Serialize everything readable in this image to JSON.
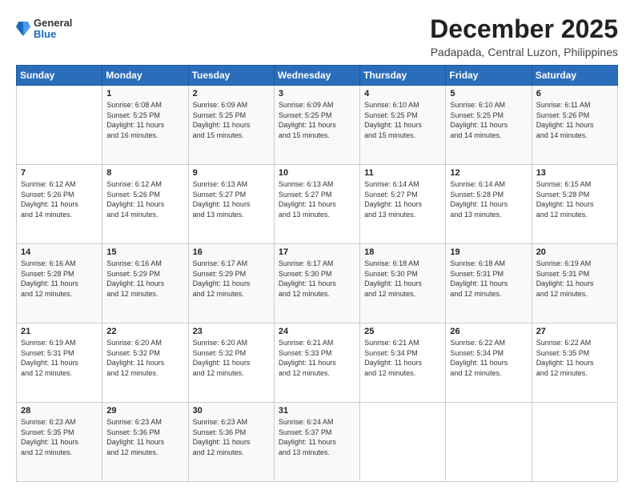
{
  "logo": {
    "general": "General",
    "blue": "Blue"
  },
  "title": "December 2025",
  "location": "Padapada, Central Luzon, Philippines",
  "days_header": [
    "Sunday",
    "Monday",
    "Tuesday",
    "Wednesday",
    "Thursday",
    "Friday",
    "Saturday"
  ],
  "weeks": [
    [
      {
        "day": "",
        "info": ""
      },
      {
        "day": "1",
        "info": "Sunrise: 6:08 AM\nSunset: 5:25 PM\nDaylight: 11 hours\nand 16 minutes."
      },
      {
        "day": "2",
        "info": "Sunrise: 6:09 AM\nSunset: 5:25 PM\nDaylight: 11 hours\nand 15 minutes."
      },
      {
        "day": "3",
        "info": "Sunrise: 6:09 AM\nSunset: 5:25 PM\nDaylight: 11 hours\nand 15 minutes."
      },
      {
        "day": "4",
        "info": "Sunrise: 6:10 AM\nSunset: 5:25 PM\nDaylight: 11 hours\nand 15 minutes."
      },
      {
        "day": "5",
        "info": "Sunrise: 6:10 AM\nSunset: 5:25 PM\nDaylight: 11 hours\nand 14 minutes."
      },
      {
        "day": "6",
        "info": "Sunrise: 6:11 AM\nSunset: 5:26 PM\nDaylight: 11 hours\nand 14 minutes."
      }
    ],
    [
      {
        "day": "7",
        "info": "Sunrise: 6:12 AM\nSunset: 5:26 PM\nDaylight: 11 hours\nand 14 minutes."
      },
      {
        "day": "8",
        "info": "Sunrise: 6:12 AM\nSunset: 5:26 PM\nDaylight: 11 hours\nand 14 minutes."
      },
      {
        "day": "9",
        "info": "Sunrise: 6:13 AM\nSunset: 5:27 PM\nDaylight: 11 hours\nand 13 minutes."
      },
      {
        "day": "10",
        "info": "Sunrise: 6:13 AM\nSunset: 5:27 PM\nDaylight: 11 hours\nand 13 minutes."
      },
      {
        "day": "11",
        "info": "Sunrise: 6:14 AM\nSunset: 5:27 PM\nDaylight: 11 hours\nand 13 minutes."
      },
      {
        "day": "12",
        "info": "Sunrise: 6:14 AM\nSunset: 5:28 PM\nDaylight: 11 hours\nand 13 minutes."
      },
      {
        "day": "13",
        "info": "Sunrise: 6:15 AM\nSunset: 5:28 PM\nDaylight: 11 hours\nand 12 minutes."
      }
    ],
    [
      {
        "day": "14",
        "info": "Sunrise: 6:16 AM\nSunset: 5:28 PM\nDaylight: 11 hours\nand 12 minutes."
      },
      {
        "day": "15",
        "info": "Sunrise: 6:16 AM\nSunset: 5:29 PM\nDaylight: 11 hours\nand 12 minutes."
      },
      {
        "day": "16",
        "info": "Sunrise: 6:17 AM\nSunset: 5:29 PM\nDaylight: 11 hours\nand 12 minutes."
      },
      {
        "day": "17",
        "info": "Sunrise: 6:17 AM\nSunset: 5:30 PM\nDaylight: 11 hours\nand 12 minutes."
      },
      {
        "day": "18",
        "info": "Sunrise: 6:18 AM\nSunset: 5:30 PM\nDaylight: 11 hours\nand 12 minutes."
      },
      {
        "day": "19",
        "info": "Sunrise: 6:18 AM\nSunset: 5:31 PM\nDaylight: 11 hours\nand 12 minutes."
      },
      {
        "day": "20",
        "info": "Sunrise: 6:19 AM\nSunset: 5:31 PM\nDaylight: 11 hours\nand 12 minutes."
      }
    ],
    [
      {
        "day": "21",
        "info": "Sunrise: 6:19 AM\nSunset: 5:31 PM\nDaylight: 11 hours\nand 12 minutes."
      },
      {
        "day": "22",
        "info": "Sunrise: 6:20 AM\nSunset: 5:32 PM\nDaylight: 11 hours\nand 12 minutes."
      },
      {
        "day": "23",
        "info": "Sunrise: 6:20 AM\nSunset: 5:32 PM\nDaylight: 11 hours\nand 12 minutes."
      },
      {
        "day": "24",
        "info": "Sunrise: 6:21 AM\nSunset: 5:33 PM\nDaylight: 11 hours\nand 12 minutes."
      },
      {
        "day": "25",
        "info": "Sunrise: 6:21 AM\nSunset: 5:34 PM\nDaylight: 11 hours\nand 12 minutes."
      },
      {
        "day": "26",
        "info": "Sunrise: 6:22 AM\nSunset: 5:34 PM\nDaylight: 11 hours\nand 12 minutes."
      },
      {
        "day": "27",
        "info": "Sunrise: 6:22 AM\nSunset: 5:35 PM\nDaylight: 11 hours\nand 12 minutes."
      }
    ],
    [
      {
        "day": "28",
        "info": "Sunrise: 6:23 AM\nSunset: 5:35 PM\nDaylight: 11 hours\nand 12 minutes."
      },
      {
        "day": "29",
        "info": "Sunrise: 6:23 AM\nSunset: 5:36 PM\nDaylight: 11 hours\nand 12 minutes."
      },
      {
        "day": "30",
        "info": "Sunrise: 6:23 AM\nSunset: 5:36 PM\nDaylight: 11 hours\nand 12 minutes."
      },
      {
        "day": "31",
        "info": "Sunrise: 6:24 AM\nSunset: 5:37 PM\nDaylight: 11 hours\nand 13 minutes."
      },
      {
        "day": "",
        "info": ""
      },
      {
        "day": "",
        "info": ""
      },
      {
        "day": "",
        "info": ""
      }
    ]
  ]
}
